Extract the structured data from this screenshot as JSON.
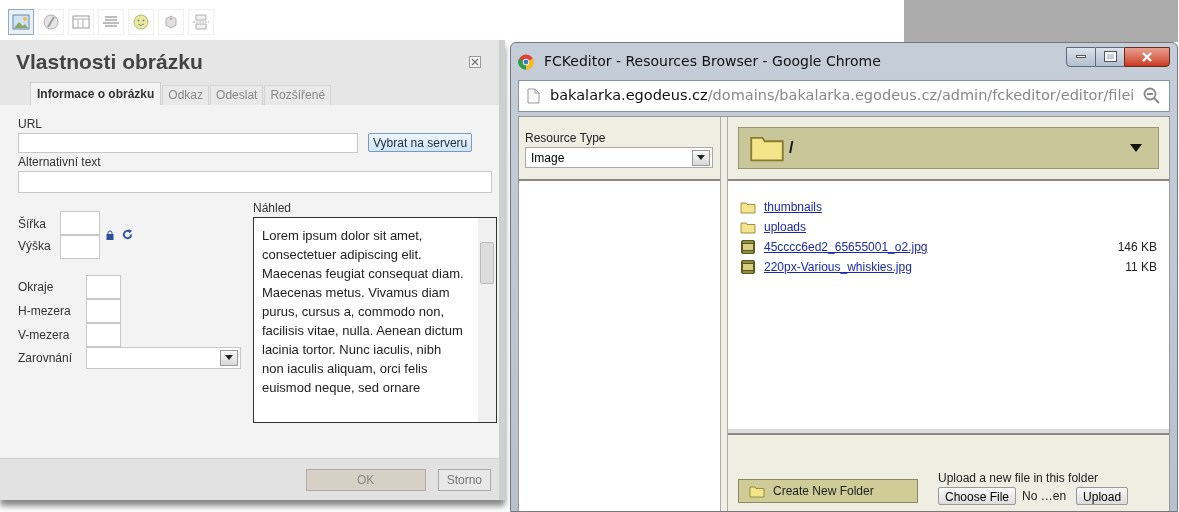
{
  "toolbar": [
    {
      "kind": "image",
      "selected": true
    },
    {
      "kind": "flash",
      "selected": false
    },
    {
      "kind": "table",
      "selected": false
    },
    {
      "kind": "rule",
      "selected": false
    },
    {
      "kind": "smiley",
      "selected": false
    },
    {
      "kind": "special",
      "selected": false
    },
    {
      "kind": "pagebreak",
      "selected": false
    }
  ],
  "dialog": {
    "title": "Vlastnosti obrázku",
    "tabs": [
      {
        "label": "Informace o obrázku",
        "selected": true
      },
      {
        "label": "Odkaz",
        "selected": false
      },
      {
        "label": "Odeslat",
        "selected": false
      },
      {
        "label": "Rozšířené",
        "selected": false
      }
    ],
    "url_label": "URL",
    "browse_button": "Vybrat na serveru",
    "alt_label": "Alternativní text",
    "width_label": "Šířka",
    "height_label": "Výška",
    "spacing_fields": [
      "Okraje",
      "H-mezera",
      "V-mezera"
    ],
    "align_label": "Zarovnání",
    "preview_label": "Náhled",
    "preview_text": "Lorem ipsum dolor sit amet, consectetuer adipiscing elit. Maecenas feugiat consequat diam. Maecenas metus. Vivamus diam purus, cursus a, commodo non, facilisis vitae, nulla. Aenean dictum lacinia tortor. Nunc iaculis, nibh non iaculis aliquam, orci felis euismod neque, sed ornare",
    "buttons": [
      {
        "label": "OK",
        "disabled": true
      },
      {
        "label": "Storno",
        "disabled": false
      }
    ]
  },
  "browser": {
    "title": "FCKeditor - Resources Browser - Google Chrome",
    "url_host": "bakalarka.egodeus.cz",
    "url_path": "/domains/bakalarka.egodeus.cz/admin/fckeditor/editor/filei",
    "resource_type_label": "Resource Type",
    "resource_type_value": "Image",
    "current_folder": "/",
    "files": [
      {
        "kind": "folder",
        "name": "thumbnails"
      },
      {
        "kind": "folder",
        "name": "uploads"
      },
      {
        "kind": "file",
        "name": "45cccc6ed2_65655001_o2.jpg",
        "size": "146 KB"
      },
      {
        "kind": "file",
        "name": "220px-Various_whiskies.jpg",
        "size": "11 KB"
      }
    ],
    "create_folder_button": "Create New Folder",
    "upload_label": "Upload a new file in this folder",
    "choose_file_button": "Choose File",
    "file_status": "No …en",
    "upload_button": "Upload"
  }
}
